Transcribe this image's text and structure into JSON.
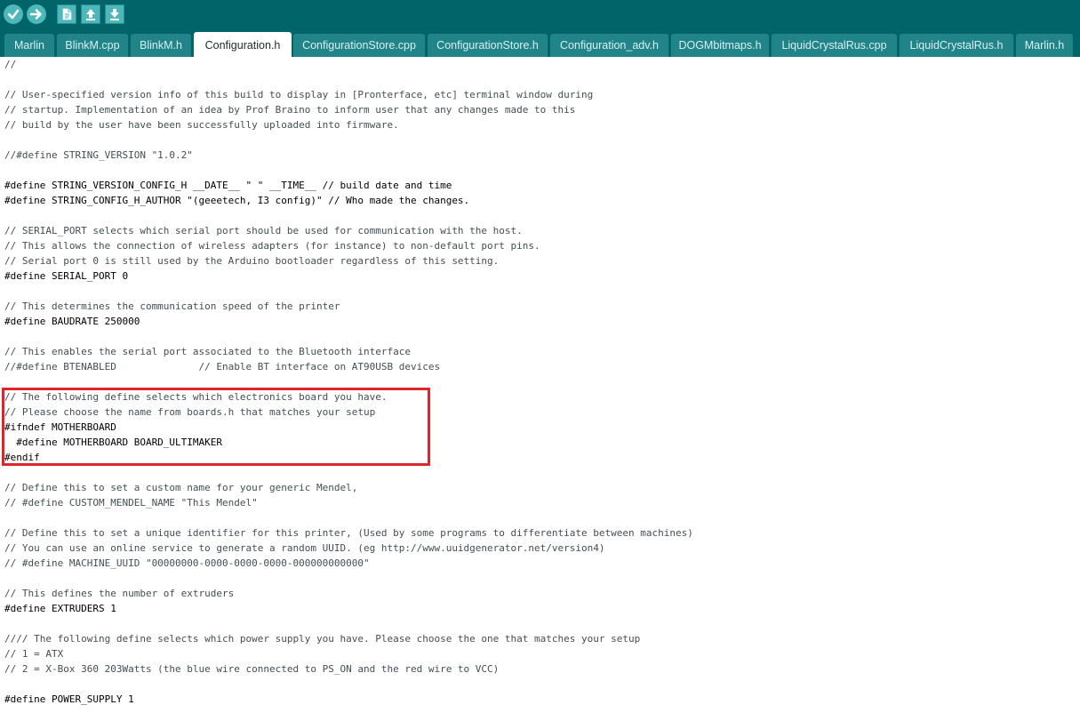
{
  "toolbar": {
    "buttons": [
      {
        "name": "verify-button",
        "icon": "checkmark-icon"
      },
      {
        "name": "upload-button",
        "icon": "arrow-right-icon"
      },
      {
        "name": "new-button",
        "icon": "new-file-icon"
      },
      {
        "name": "open-button",
        "icon": "arrow-up-icon"
      },
      {
        "name": "save-button",
        "icon": "arrow-down-icon"
      }
    ]
  },
  "tabs": [
    {
      "label": "Marlin"
    },
    {
      "label": "BlinkM.cpp"
    },
    {
      "label": "BlinkM.h"
    },
    {
      "label": "Configuration.h",
      "active": true
    },
    {
      "label": "ConfigurationStore.cpp"
    },
    {
      "label": "ConfigurationStore.h"
    },
    {
      "label": "Configuration_adv.h"
    },
    {
      "label": "DOGMbitmaps.h"
    },
    {
      "label": "LiquidCrystalRus.cpp"
    },
    {
      "label": "LiquidCrystalRus.h"
    },
    {
      "label": "Marlin.h"
    }
  ],
  "code_lines": [
    "//",
    "",
    "// User-specified version info of this build to display in [Pronterface, etc] terminal window during",
    "// startup. Implementation of an idea by Prof Braino to inform user that any changes made to this",
    "// build by the user have been successfully uploaded into firmware.",
    "",
    "//#define STRING_VERSION \"1.0.2\"",
    "",
    "#define STRING_VERSION_CONFIG_H __DATE__ \" \" __TIME__ // build date and time",
    "#define STRING_CONFIG_H_AUTHOR \"(geeetech, I3 config)\" // Who made the changes.",
    "",
    "// SERIAL_PORT selects which serial port should be used for communication with the host.",
    "// This allows the connection of wireless adapters (for instance) to non-default port pins.",
    "// Serial port 0 is still used by the Arduino bootloader regardless of this setting.",
    "#define SERIAL_PORT 0",
    "",
    "// This determines the communication speed of the printer",
    "#define BAUDRATE 250000",
    "",
    "// This enables the serial port associated to the Bluetooth interface",
    "//#define BTENABLED              // Enable BT interface on AT90USB devices",
    "",
    "// The following define selects which electronics board you have.",
    "// Please choose the name from boards.h that matches your setup",
    "#ifndef MOTHERBOARD",
    "  #define MOTHERBOARD BOARD_ULTIMAKER",
    "#endif",
    "",
    "// Define this to set a custom name for your generic Mendel,",
    "// #define CUSTOM_MENDEL_NAME \"This Mendel\"",
    "",
    "// Define this to set a unique identifier for this printer, (Used by some programs to differentiate between machines)",
    "// You can use an online service to generate a random UUID. (eg http://www.uuidgenerator.net/version4)",
    "// #define MACHINE_UUID \"00000000-0000-0000-0000-000000000000\"",
    "",
    "// This defines the number of extruders",
    "#define EXTRUDERS 1",
    "",
    "//// The following define selects which power supply you have. Please choose the one that matches your setup",
    "// 1 = ATX",
    "// 2 = X-Box 360 203Watts (the blue wire connected to PS_ON and the red wire to VCC)",
    "",
    "#define POWER_SUPPLY 1"
  ],
  "highlight": {
    "color": "#e0242a",
    "first_line": 22,
    "last_line": 26
  }
}
